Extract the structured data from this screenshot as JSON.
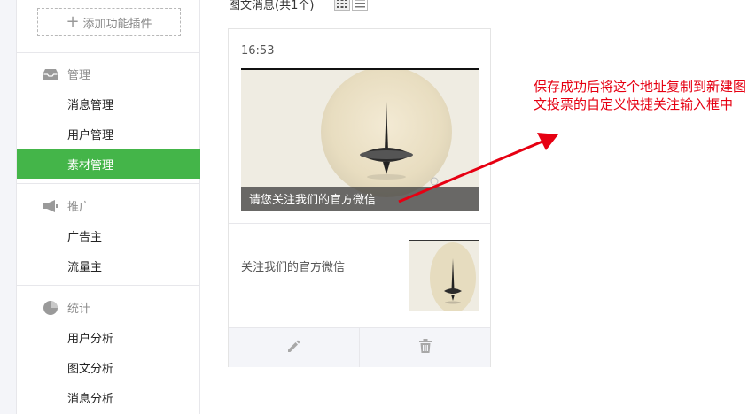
{
  "sidebar": {
    "add_plugin": "添加功能插件",
    "sections": [
      {
        "title": "管理",
        "icon": "inbox-icon",
        "items": [
          "消息管理",
          "用户管理",
          "素材管理"
        ]
      },
      {
        "title": "推广",
        "icon": "megaphone-icon",
        "items": [
          "广告主",
          "流量主"
        ]
      },
      {
        "title": "统计",
        "icon": "pie-chart-icon",
        "items": [
          "用户分析",
          "图文分析",
          "消息分析"
        ]
      }
    ],
    "active_item": "素材管理"
  },
  "content": {
    "title": "图文消息(共1个)",
    "card": {
      "time": "16:53",
      "cover_caption": "请您关注我们的官方微信",
      "sub_title": "关注我们的官方微信"
    }
  },
  "annotation": {
    "text": "保存成功后将这个地址复制到新建图文投票的自定义快捷关注输入框中",
    "color": "#e60012"
  },
  "colors": {
    "accent": "#44b549"
  }
}
